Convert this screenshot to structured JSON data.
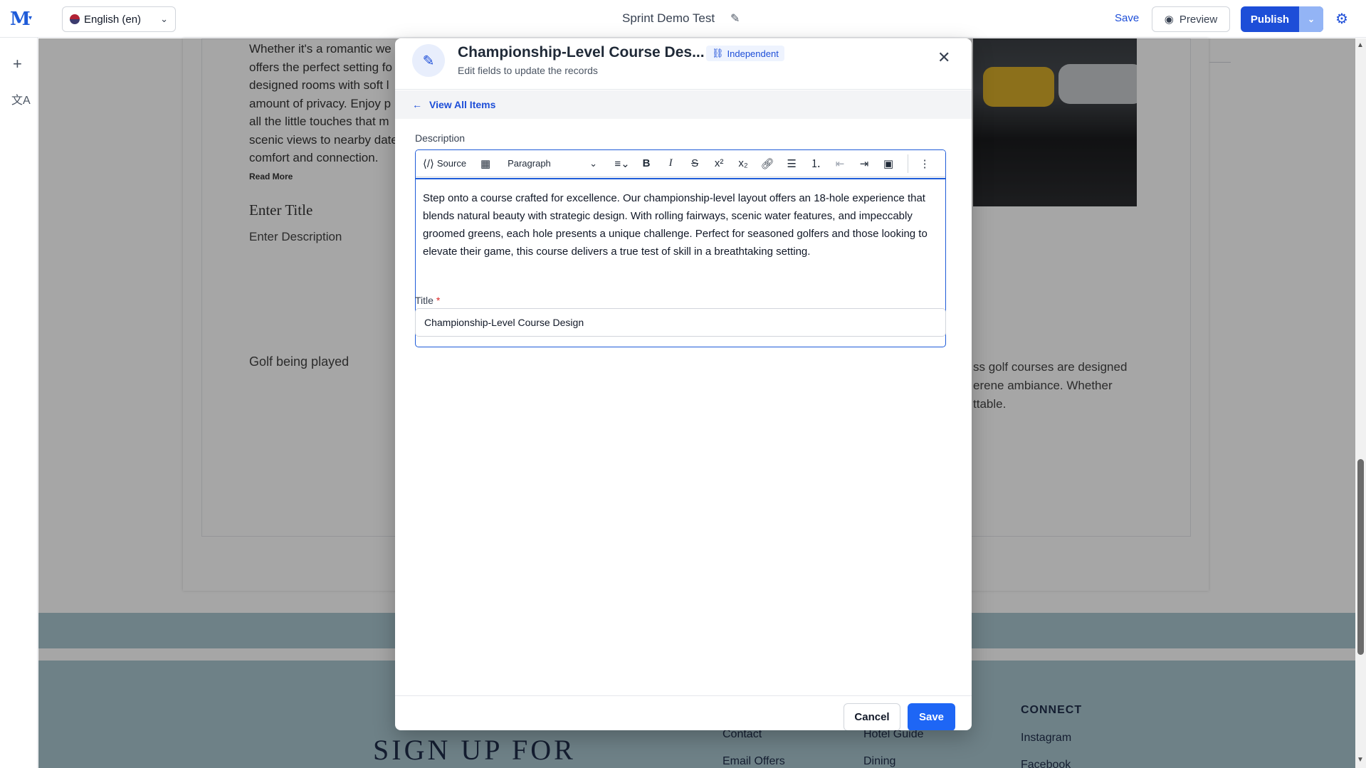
{
  "topbar": {
    "logo": "M",
    "language": "English (en)",
    "document_title": "Sprint Demo Test",
    "save_label": "Save",
    "preview_label": "Preview",
    "publish_label": "Publish"
  },
  "background": {
    "paragraph_lines": [
      "Whether it's a romantic we",
      "offers the perfect setting fo",
      "designed rooms with soft l",
      "amount of privacy. Enjoy p",
      "all the little touches that m",
      "scenic views to nearby date",
      "comfort and connection."
    ],
    "read_more": "Read More",
    "enter_title": "Enter Title",
    "enter_description": "Enter Description",
    "golf_alt": "Golf being played",
    "right_text": "ss golf courses are designed\nerene ambiance. Whether\nttable.",
    "signup": "SIGN UP FOR",
    "footer": {
      "col1": [
        "Contact",
        "Email Offers"
      ],
      "col2": [
        "Hotel Guide",
        "Dining"
      ],
      "connect_heading": "CONNECT",
      "col3": [
        "Instagram",
        "Facebook"
      ]
    }
  },
  "modal": {
    "title": "Championship-Level Course Des...",
    "badge": "Independent",
    "subtitle": "Edit fields to update the records",
    "nav_back": "View All Items",
    "description_label": "Description",
    "toolbar": {
      "source": "Source",
      "paragraph": "Paragraph"
    },
    "description_text": "Step onto a course crafted for excellence. Our championship-level layout offers an 18-hole experience that blends natural beauty with strategic design. With rolling fairways, scenic water features, and impeccably groomed greens, each hole presents a unique challenge. Perfect for seasoned golfers and those looking to elevate their game, this course delivers a true test of skill in a breathtaking setting.",
    "title_label": "Title",
    "title_required": "*",
    "title_value": "Championship-Level Course Design",
    "cancel_label": "Cancel",
    "save_label": "Save"
  }
}
